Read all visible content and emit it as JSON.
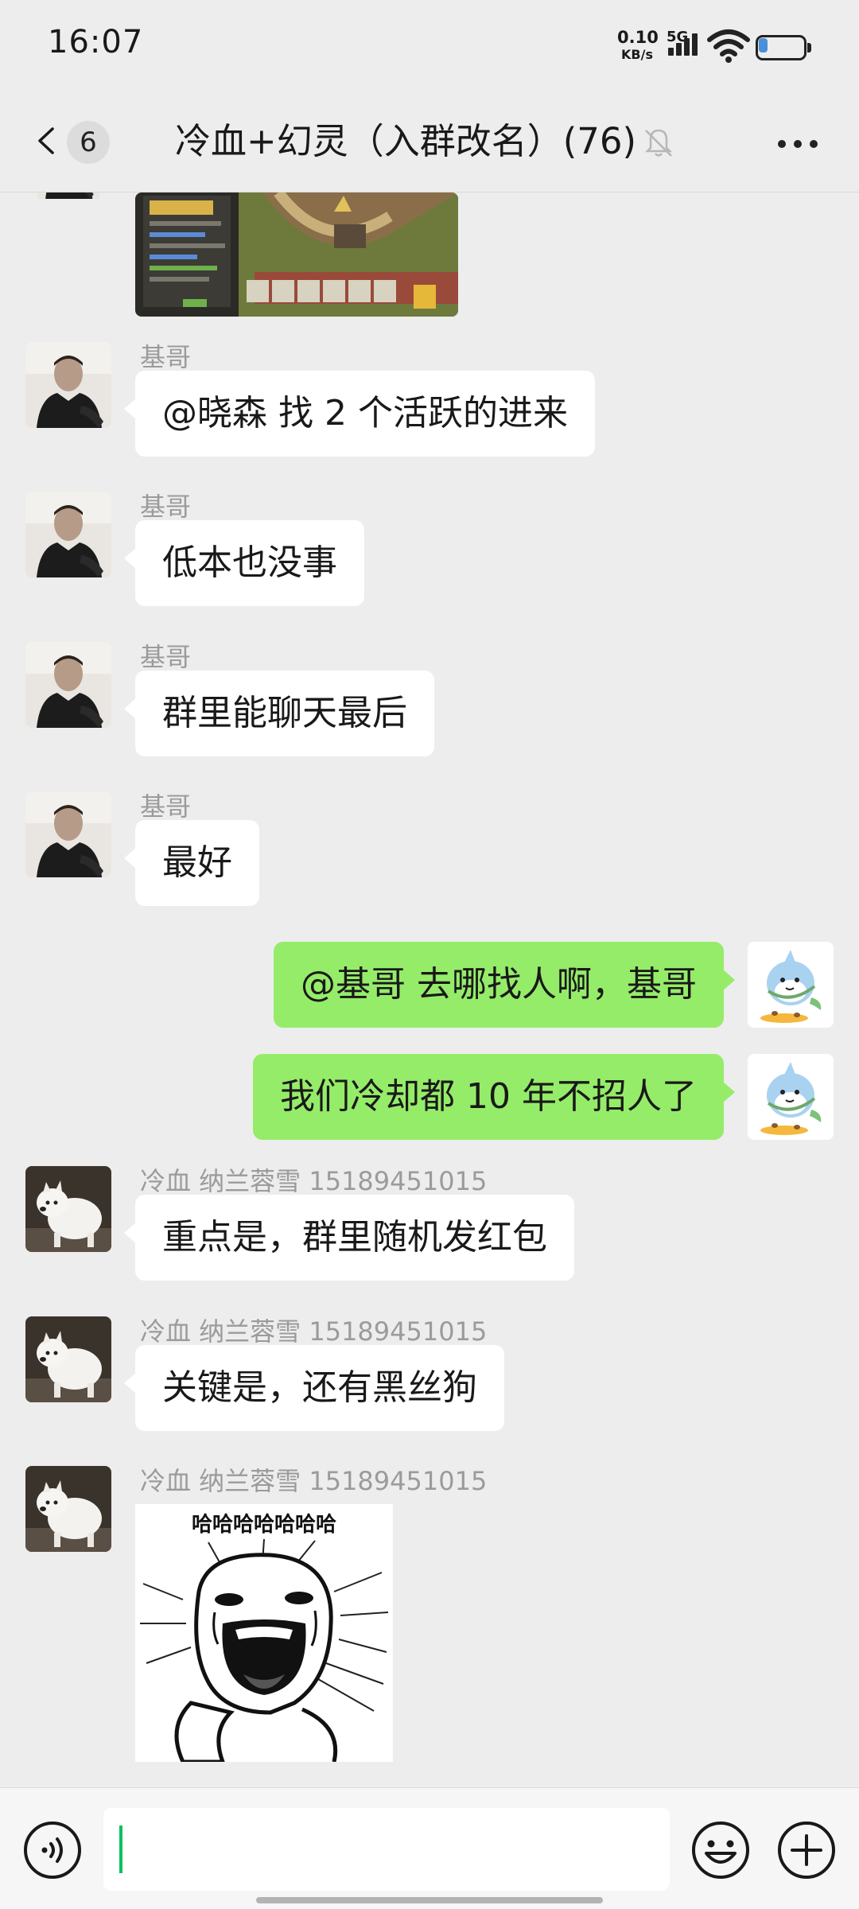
{
  "status_bar": {
    "time": "16:07",
    "net_speed_value": "0.10",
    "net_speed_unit": "KB/s",
    "network_type": "5G",
    "signal_level": 4,
    "battery_level": 0.2,
    "battery_color": "#4a90d9"
  },
  "nav": {
    "unread_count": "6",
    "title": "冷血+幻灵（入群改名）(76)",
    "icons": [
      "chevron-left-icon",
      "mute-bell-icon",
      "more-dots-icon"
    ]
  },
  "messages": [
    {
      "type": "image",
      "direction": "in",
      "sender": "",
      "image": "clash-of-clans-game-screenshot"
    },
    {
      "type": "text",
      "direction": "in",
      "sender": "基哥",
      "text": "@晓森  找 2 个活跃的进来"
    },
    {
      "type": "text",
      "direction": "in",
      "sender": "基哥",
      "text": "低本也没事"
    },
    {
      "type": "text",
      "direction": "in",
      "sender": "基哥",
      "text": "群里能聊天最后"
    },
    {
      "type": "text",
      "direction": "in",
      "sender": "基哥",
      "text": "最好"
    },
    {
      "type": "text",
      "direction": "out",
      "sender": "",
      "text": "@基哥  去哪找人啊，基哥"
    },
    {
      "type": "text",
      "direction": "out",
      "sender": "",
      "text": "我们冷却都 10 年不招人了"
    },
    {
      "type": "text",
      "direction": "in",
      "sender": "冷血 纳兰蓉雪 15189451015",
      "text": "重点是，群里随机发红包"
    },
    {
      "type": "text",
      "direction": "in",
      "sender": "冷血 纳兰蓉雪 15189451015",
      "text": "关键是，还有黑丝狗"
    },
    {
      "type": "image",
      "direction": "in",
      "sender": "冷血 纳兰蓉雪 15189451015",
      "image": "laughing-meme-sticker",
      "caption": "哈哈哈哈哈哈哈"
    }
  ],
  "input_bar": {
    "value": "",
    "icons": [
      "voice-icon",
      "emoji-icon",
      "plus-icon"
    ]
  },
  "colors": {
    "background": "#ededed",
    "incoming_bubble": "#ffffff",
    "outgoing_bubble": "#95ec69",
    "caret": "#07c160"
  }
}
